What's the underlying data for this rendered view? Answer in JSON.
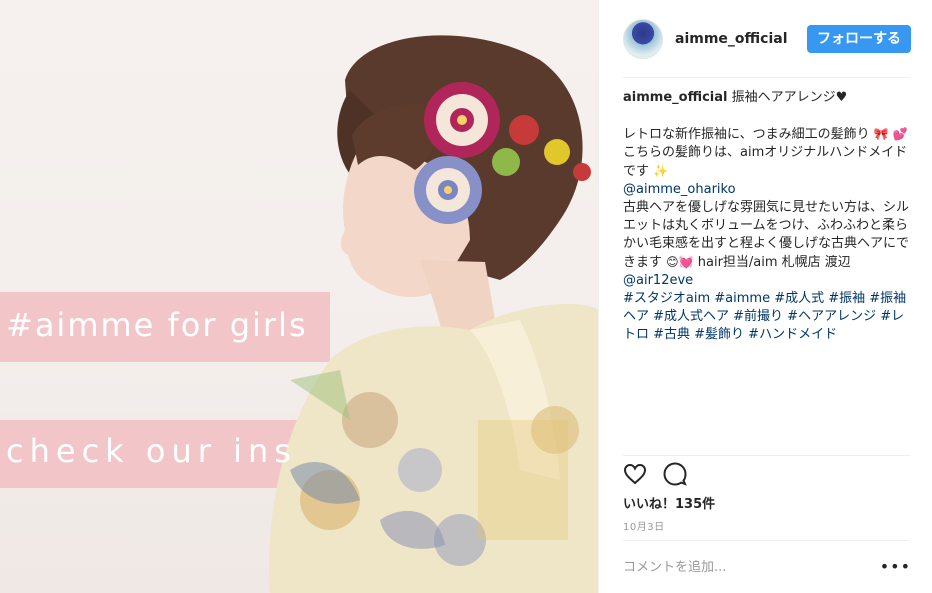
{
  "photo": {
    "banner_line_1": "#aimme for girls",
    "banner_line_2": "check our ins"
  },
  "header": {
    "username": "aimme_official",
    "follow_label": "フォローする"
  },
  "caption": {
    "username": "aimme_official",
    "title": "振袖ヘアアレンジ♥",
    "line_1": "レトロな新作振袖に、つまみ細工の髪飾り",
    "emoji_1": "🎀",
    "emoji_2": "💕",
    "line_2": "こちらの髪飾りは、aimオリジナルハンドメイドです",
    "emoji_3": "✨",
    "mention_1": "@aimme_ohariko",
    "line_3": "古典ヘアを優しげな雰囲気に見せたい方は、シルエットは丸くボリュームをつけ、ふわふわと柔らかい毛束感を出すと程よく優しげな古典ヘアにできます",
    "emoji_4": "😊💓",
    "line_4": "hair担当/aim 札幌店 渡辺",
    "mention_2": "@air12eve",
    "hashtags": "#スタジオaim #aimme #成人式 #振袖 #振袖ヘア #成人式ヘア #前撮り #ヘアアレンジ #レトロ #古典 #髪飾り #ハンドメイド"
  },
  "actions": {
    "like_icon": "heart-icon",
    "comment_icon": "comment-icon"
  },
  "likes_text": "いいね！135件",
  "date_text": "10月3日",
  "comment": {
    "placeholder": "コメントを追加...",
    "more_label": "•••"
  },
  "colors": {
    "accent": "#3897f0",
    "link": "#003569",
    "banner_pink": "#f2c6c9"
  }
}
